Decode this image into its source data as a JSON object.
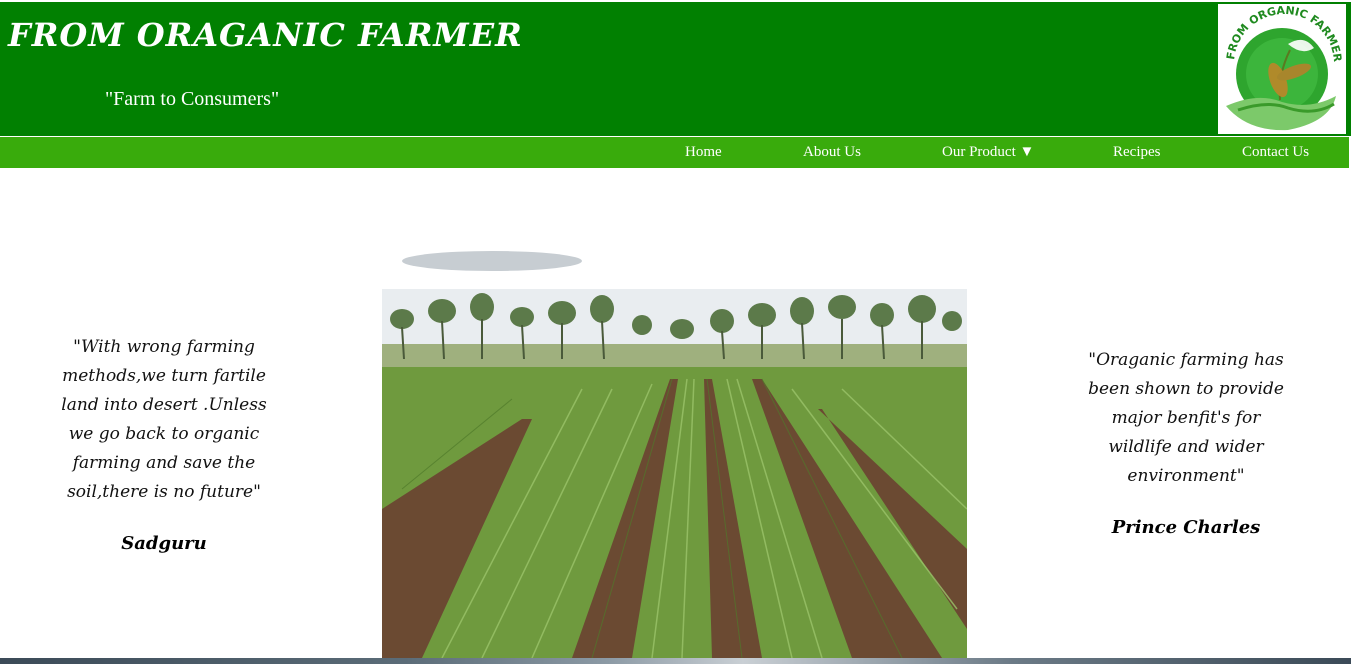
{
  "header": {
    "title": "FROM ORAGANIC FARMER",
    "tagline": "\"Farm to Consumers\"",
    "logo_text": "FROM ORGANIC FARMER"
  },
  "nav": {
    "items": [
      {
        "label": "Home"
      },
      {
        "label": "About Us"
      },
      {
        "label": "Our Product ▼"
      },
      {
        "label": "Recipes"
      },
      {
        "label": "Contact Us"
      }
    ]
  },
  "quotes": {
    "left": {
      "lines": [
        "\"With wrong farming",
        "methods,we turn fartile",
        "land into desert .Unless",
        "we go back to organic",
        "farming and save the",
        "soil,there is no future\""
      ],
      "author": "Sadguru"
    },
    "right": {
      "lines": [
        "\"Oraganic farming has",
        "been shown to provide",
        "major benfit's for",
        "wildlife and wider",
        "environment\""
      ],
      "author": "Prince Charles"
    }
  },
  "colors": {
    "header_bg": "#018001",
    "nav_bg": "#39ab0c",
    "text_white": "#ffffff"
  },
  "icons": {
    "logo": "organic-farmer-logo"
  }
}
